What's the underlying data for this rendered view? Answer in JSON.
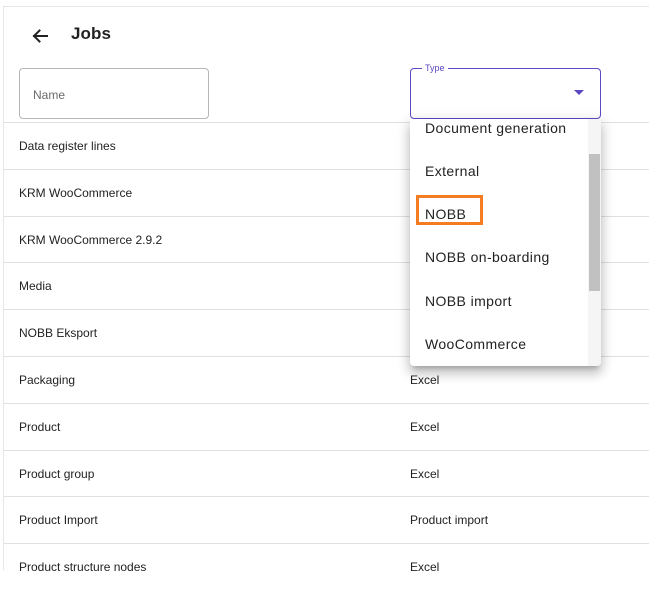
{
  "header": {
    "title": "Jobs",
    "back_icon": "arrow-left-icon"
  },
  "filters": {
    "name": {
      "placeholder": "Name",
      "value": ""
    },
    "type": {
      "label": "Type",
      "value": "",
      "accent_color": "#5d48c4"
    }
  },
  "rows": [
    {
      "name": "Data register lines",
      "type": ""
    },
    {
      "name": "KRM WooCommerce",
      "type": ""
    },
    {
      "name": "KRM WooCommerce 2.9.2",
      "type": ""
    },
    {
      "name": "Media",
      "type": ""
    },
    {
      "name": "NOBB Eksport",
      "type": ""
    },
    {
      "name": "Packaging",
      "type": "Excel"
    },
    {
      "name": "Product",
      "type": "Excel"
    },
    {
      "name": "Product group",
      "type": "Excel"
    },
    {
      "name": "Product Import",
      "type": "Product import"
    },
    {
      "name": "Product structure nodes",
      "type": "Excel"
    }
  ],
  "type_dropdown": {
    "options": [
      "Document generation",
      "External",
      "NOBB",
      "NOBB on-boarding",
      "NOBB import",
      "WooCommerce"
    ],
    "highlighted_option": "NOBB",
    "highlight_color": "#f57c20"
  }
}
